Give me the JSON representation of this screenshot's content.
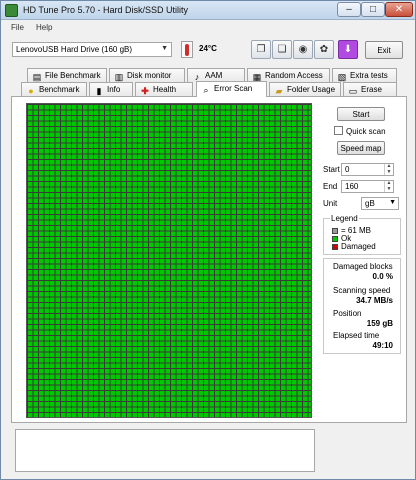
{
  "window": {
    "title": "HD Tune Pro 5.70 - Hard Disk/SSD Utility",
    "colors": {
      "map_ok": "#00c800",
      "map_damaged": "#cc0000",
      "accent_purple": "#b04ae0"
    }
  },
  "menu": {
    "file": "File",
    "help": "Help"
  },
  "toolbar": {
    "drive": "LenovoUSB Hard Drive (160 gB)",
    "temperature": "24°C",
    "exit": "Exit"
  },
  "tabs_top": [
    {
      "label": "File Benchmark",
      "icon": "file-benchmark-icon"
    },
    {
      "label": "Disk monitor",
      "icon": "disk-monitor-icon"
    },
    {
      "label": "AAM",
      "icon": "speaker-icon"
    },
    {
      "label": "Random Access",
      "icon": "random-access-icon"
    },
    {
      "label": "Extra tests",
      "icon": "extra-tests-icon"
    }
  ],
  "tabs_bottom": [
    {
      "label": "Benchmark",
      "icon": "benchmark-icon"
    },
    {
      "label": "Info",
      "icon": "info-icon"
    },
    {
      "label": "Health",
      "icon": "health-cross-icon"
    },
    {
      "label": "Error Scan",
      "icon": "error-scan-icon",
      "active": true
    },
    {
      "label": "Folder Usage",
      "icon": "folder-icon"
    },
    {
      "label": "Erase",
      "icon": "erase-icon"
    }
  ],
  "controls": {
    "start": "Start",
    "quick_scan": "Quick scan",
    "quick_scan_checked": false,
    "speed_map": "Speed map",
    "start_label": "Start",
    "start_value": "0",
    "end_label": "End",
    "end_value": "160",
    "unit_label": "Unit",
    "unit_value": "gB"
  },
  "legend": {
    "title": "Legend",
    "block": "= 61 MB",
    "ok": "Ok",
    "damaged": "Damaged"
  },
  "stats": {
    "damaged_blocks_label": "Damaged blocks",
    "damaged_blocks_value": "0.0 %",
    "scanning_speed_label": "Scanning speed",
    "scanning_speed_value": "34.7 MB/s",
    "position_label": "Position",
    "position_value": "159 gB",
    "elapsed_label": "Elapsed time",
    "elapsed_value": "49:10"
  }
}
